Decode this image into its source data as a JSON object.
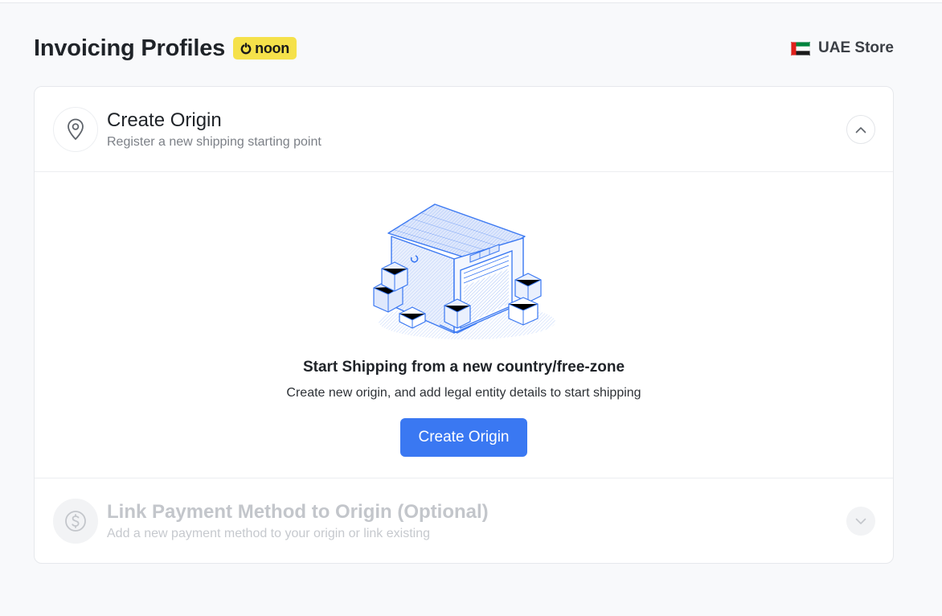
{
  "header": {
    "title": "Invoicing Profiles",
    "badge": "noon",
    "store": "UAE Store"
  },
  "icons": {
    "badge": "noon-logo",
    "store": "uae-flag-icon",
    "section1": "location-pin-icon",
    "section1_toggle": "chevron-up-icon",
    "section2": "dollar-circle-icon",
    "section2_toggle": "chevron-down-icon"
  },
  "sections": [
    {
      "title": "Create Origin",
      "subtitle": "Register a new shipping starting point",
      "expanded": true
    },
    {
      "title": "Link Payment Method to Origin (Optional)",
      "subtitle": "Add a new payment method to your origin or link existing",
      "expanded": false
    }
  ],
  "empty_state": {
    "title": "Start Shipping from a new country/free-zone",
    "subtitle": "Create new origin, and add legal entity details to start shipping",
    "button": "Create Origin"
  },
  "colors": {
    "primary": "#3a78f2",
    "badge": "#f5e14a",
    "background": "#f8f9fb"
  }
}
